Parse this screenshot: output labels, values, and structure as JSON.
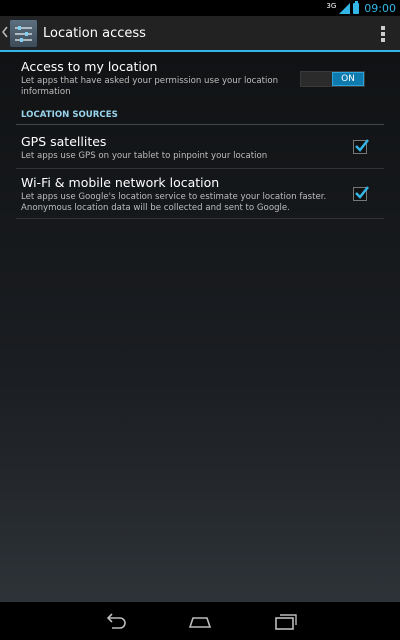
{
  "status_bar": {
    "network_type": "3G",
    "time": "09:00"
  },
  "action_bar": {
    "title": "Location access",
    "icons": {
      "back": "chevron-left-icon",
      "app": "settings-sliders-icon",
      "overflow": "overflow-menu-icon"
    }
  },
  "settings": {
    "access": {
      "title": "Access to my location",
      "description": "Let apps that have asked your permission use your location information",
      "toggle_state": "ON",
      "enabled": true
    },
    "section_header": "LOCATION SOURCES",
    "gps": {
      "title": "GPS satellites",
      "description": "Let apps use GPS on your tablet to pinpoint your location",
      "checked": true
    },
    "wifi": {
      "title": "Wi-Fi & mobile network location",
      "description": "Let apps use Google's location service to estimate your location faster. Anonymous location data will be collected and sent to Google.",
      "checked": true
    }
  },
  "nav_bar": {
    "icons": [
      "back-icon",
      "home-icon",
      "recent-apps-icon"
    ]
  },
  "colors": {
    "accent": "#33b5e5",
    "toggle_on": "#0e7aad",
    "section_header": "#9ad4ec"
  }
}
